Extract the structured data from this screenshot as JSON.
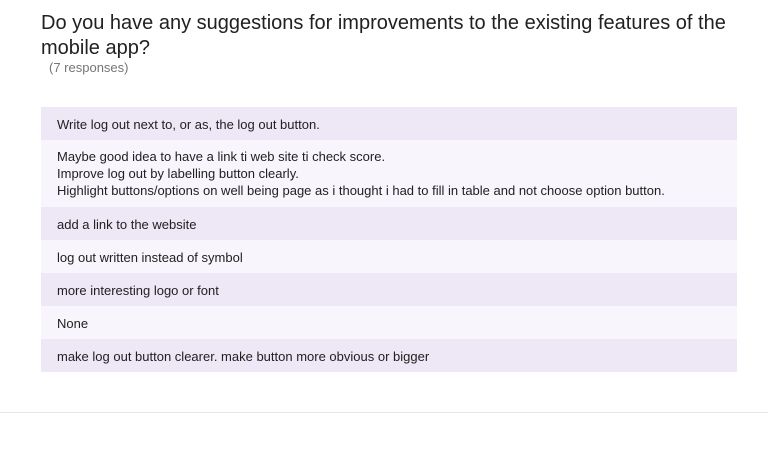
{
  "question": {
    "title": "Do you have any suggestions for improvements to the existing features of the mobile app?",
    "response_count": "(7 responses)"
  },
  "responses": [
    "Write log out next to, or as, the log out button.",
    "Maybe good idea to have a link ti web site ti check score.\nImprove log out by labelling button clearly.\nHighlight buttons/options on well being page as i thought i had to fill in table and not choose option button.",
    "add a link to the website",
    "log out written instead of symbol",
    "more interesting logo or font",
    "None",
    "make log out button clearer. make button more obvious or bigger"
  ],
  "colors": {
    "row_shade": "#ede7f6",
    "row_light": "#f8f5fc",
    "title_text": "#212121",
    "muted_text": "#757575"
  }
}
